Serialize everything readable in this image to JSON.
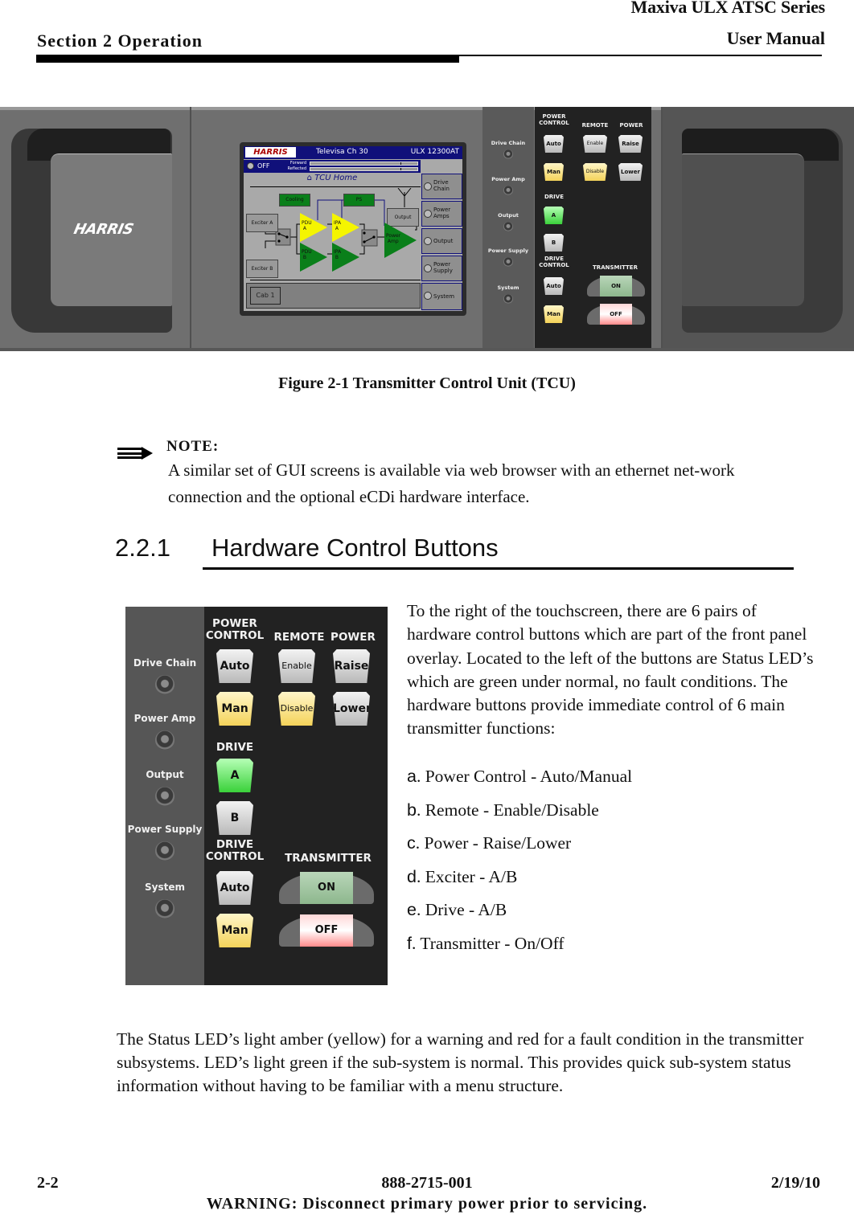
{
  "header": {
    "series": "Maxiva ULX ATSC Series",
    "manual": "User Manual",
    "section": "Section 2 Operation"
  },
  "figure": {
    "caption": "Figure 2-1  Transmitter Control Unit (TCU)",
    "brand_logo": "HARRIS",
    "touchscreen": {
      "logo": "HARRIS",
      "station": "Televisa Ch 30",
      "model": "ULX 12300AT",
      "tx_state": "OFF",
      "meters": [
        {
          "label": "Forward"
        },
        {
          "label": "Reflected"
        }
      ],
      "page_title": "TCU Home",
      "home_icon": "home-icon",
      "blocks": {
        "cooling": "Cooling",
        "ps": "PS",
        "exciter_a": "Exciter A",
        "exciter_b": "Exciter B",
        "output": "Output",
        "pdu_a": [
          "PDU",
          "A"
        ],
        "pdu_b": [
          "PDU",
          "B"
        ],
        "ipa_a": [
          "IPA",
          "A"
        ],
        "ipa_b": [
          "IPA",
          "B"
        ],
        "power_amp": [
          "Power",
          "Amp"
        ]
      },
      "side_buttons": [
        [
          "Drive",
          "Chain"
        ],
        [
          "Power",
          "Amps"
        ],
        [
          "Output",
          ""
        ],
        [
          "Power",
          "Supply"
        ],
        [
          "System",
          ""
        ]
      ],
      "cabinet": "Cab 1",
      "colors": {
        "title_bar": "#10107a",
        "active_yellow": "#f5f500",
        "normal_green": "#0a7f1a"
      }
    }
  },
  "hardware_panel": {
    "leds": [
      "Drive Chain",
      "Power Amp",
      "Output",
      "Power Supply",
      "System"
    ],
    "groups": {
      "power_control": "POWER CONTROL",
      "power_control_l1": "POWER",
      "power_control_l2": "CONTROL",
      "remote": "REMOTE",
      "power": "POWER",
      "drive": "DRIVE",
      "drive_control_l1": "DRIVE",
      "drive_control_l2": "CONTROL",
      "transmitter": "TRANSMITTER"
    },
    "buttons": {
      "pc_auto": "Auto",
      "pc_man": "Man",
      "remote_enable": "Enable",
      "remote_disable": "Disable",
      "power_raise": "Raise",
      "power_lower": "Lower",
      "drive_a": "A",
      "drive_b": "B",
      "dc_auto": "Auto",
      "dc_man": "Man",
      "tx_on": "ON",
      "tx_off": "OFF"
    }
  },
  "note": {
    "icon": "arrow-right-icon",
    "label": "NOTE:",
    "text": "A similar set of GUI screens is available via web browser with an ethernet net-work connection and the optional eCDi hardware interface."
  },
  "section": {
    "number": "2.2.1",
    "title": "Hardware Control Buttons"
  },
  "intro": "To the right of the touchscreen, there are 6 pairs of hardware control buttons which are part of the front panel overlay. Located to the left of the buttons are Status LED’s which are green under normal, no fault conditions. The hardware buttons provide immediate control of 6 main transmitter functions:",
  "functions": [
    {
      "letter": "a",
      "text": " Power Control - Auto/Manual"
    },
    {
      "letter": "b",
      "text": " Remote - Enable/Disable"
    },
    {
      "letter": "c",
      "text": " Power - Raise/Lower"
    },
    {
      "letter": "d",
      "text": " Exciter - A/B"
    },
    {
      "letter": "e",
      "text": " Drive - A/B"
    },
    {
      "letter": "f",
      "text": " Transmitter - On/Off"
    }
  ],
  "status_paragraph": "The Status LED’s light amber (yellow) for a warning and red for a fault condition in the transmitter subsystems. LED’s light green if the sub-system is normal. This provides quick sub-system status information without having to be familiar with a menu structure.",
  "footer": {
    "page": "2-2",
    "doc_number": "888-2715-001",
    "date": "2/19/10",
    "warning": "WARNING: Disconnect primary power prior to servicing."
  }
}
